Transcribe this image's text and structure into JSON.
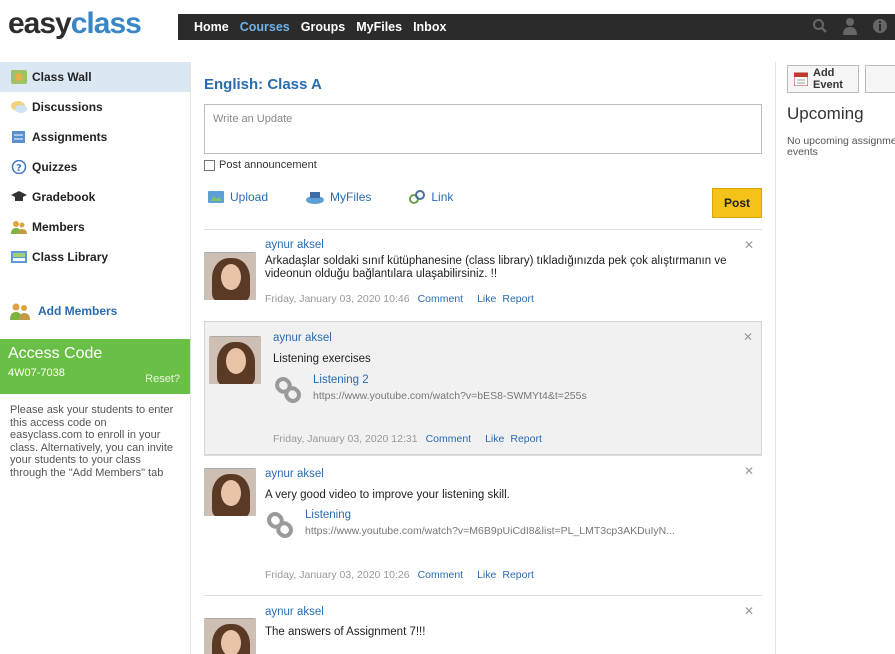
{
  "app": {
    "logo_part1": "easy",
    "logo_part2": "class"
  },
  "nav": {
    "home": "Home",
    "courses": "Courses",
    "groups": "Groups",
    "myfiles": "MyFiles",
    "inbox": "Inbox"
  },
  "sidebar": {
    "items": [
      {
        "label": "Class Wall",
        "icon": "class-wall-icon"
      },
      {
        "label": "Discussions",
        "icon": "discussions-icon"
      },
      {
        "label": "Assignments",
        "icon": "assignments-icon"
      },
      {
        "label": "Quizzes",
        "icon": "quizzes-icon"
      },
      {
        "label": "Gradebook",
        "icon": "gradebook-icon"
      },
      {
        "label": "Members",
        "icon": "members-icon"
      },
      {
        "label": "Class Library",
        "icon": "class-library-icon"
      }
    ],
    "add_members": "Add Members",
    "access_code_title": "Access Code",
    "access_code": "4W07-7038",
    "reset": "Reset?",
    "help_text": "Please ask your students to enter this access code on easyclass.com to enroll in your class. Alternatively, you can invite your students to your class through the \"Add Members\" tab"
  },
  "main": {
    "class_title": "English: Class A",
    "update_placeholder": "Write an Update",
    "post_announcement": "Post announcement",
    "upload": "Upload",
    "myfiles": "MyFiles",
    "link": "Link",
    "post_button": "Post"
  },
  "posts": [
    {
      "author": "aynur aksel",
      "text": "Arkadaşlar soldaki sınıf kütüphanesine (class library) tıkladığınızda pek çok alıştırmanın ve videonun olduğu bağlantılara ulaşabilirsiniz. !!",
      "date": "Friday, January 03, 2020 10:46",
      "comment": "Comment",
      "like": "Like",
      "report": "Report"
    },
    {
      "author": "aynur aksel",
      "text": "Listening exercises",
      "link_title": "Listening 2",
      "link_url": "https://www.youtube.com/watch?v=bES8-SWMYt4&t=255s",
      "date": "Friday, January 03, 2020 12:31",
      "comment": "Comment",
      "like": "Like",
      "report": "Report"
    },
    {
      "author": "aynur aksel",
      "text": "A very good video to improve your listening skill.",
      "link_title": "Listening",
      "link_url": "https://www.youtube.com/watch?v=M6B9pUiCdI8&list=PL_LMT3cp3AKDuIyN...",
      "date": "Friday, January 03, 2020 10:26",
      "comment": "Comment",
      "like": "Like",
      "report": "Report"
    },
    {
      "author": "aynur aksel",
      "text": "The answers of Assignment 7!!!"
    }
  ],
  "right": {
    "add_event": "Add Event",
    "upcoming": "Upcoming",
    "no_upcoming": "No upcoming assignments or events"
  },
  "colors": {
    "accent": "#2a6bb0",
    "access_green": "#6ac046",
    "post_button": "#f5c21a",
    "topbar": "#2b2b2b"
  }
}
